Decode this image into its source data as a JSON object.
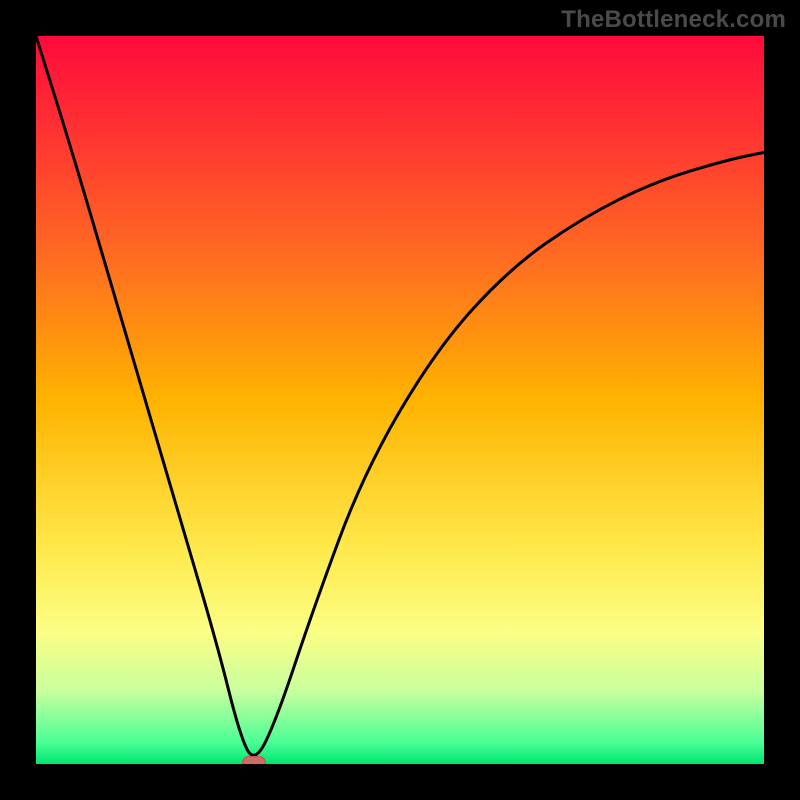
{
  "watermark": "TheBottleneck.com",
  "chart_data": {
    "type": "line",
    "title": "",
    "xlabel": "",
    "ylabel": "",
    "xlim": [
      0,
      100
    ],
    "ylim": [
      0,
      100
    ],
    "series": [
      {
        "name": "bottleneck-curve",
        "x": [
          0,
          5,
          10,
          15,
          20,
          25,
          28,
          30,
          33,
          38,
          45,
          55,
          65,
          75,
          85,
          95,
          100
        ],
        "values": [
          100,
          84,
          67,
          50,
          33,
          16,
          4,
          0,
          6,
          21,
          40,
          57,
          68,
          75,
          80,
          83,
          84
        ]
      }
    ],
    "marker": {
      "x": 30,
      "y": 0
    },
    "colors": {
      "gradient_stops": [
        {
          "offset": 0.0,
          "color": "#ff0a3b"
        },
        {
          "offset": 0.12,
          "color": "#ff2f33"
        },
        {
          "offset": 0.3,
          "color": "#ff6a22"
        },
        {
          "offset": 0.5,
          "color": "#ffb300"
        },
        {
          "offset": 0.7,
          "color": "#ffe84a"
        },
        {
          "offset": 0.82,
          "color": "#fbff85"
        },
        {
          "offset": 0.9,
          "color": "#c8ff9e"
        },
        {
          "offset": 0.97,
          "color": "#4aff96"
        },
        {
          "offset": 1.0,
          "color": "#00e56e"
        }
      ],
      "curve": "#000000",
      "marker_fill": "#cf6b63",
      "marker_stroke": "#b55a52"
    }
  }
}
